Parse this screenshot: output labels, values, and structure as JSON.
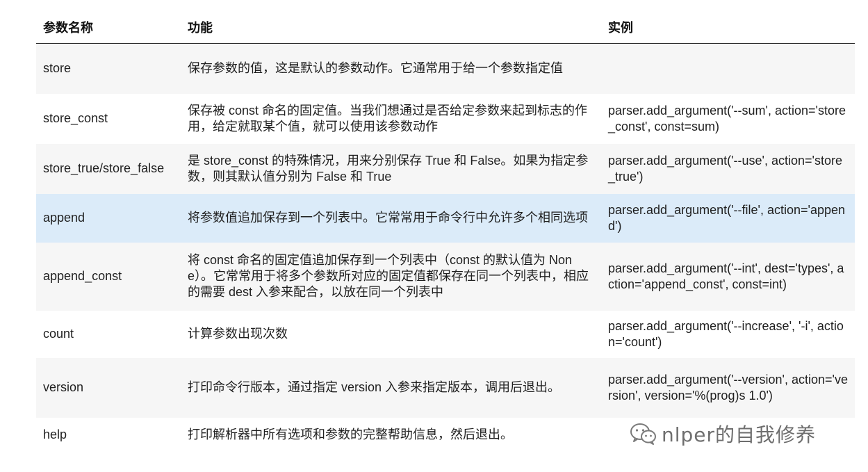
{
  "table": {
    "headers": [
      "参数名称",
      "功能",
      "实例"
    ],
    "rows": [
      {
        "name": "store",
        "function": "保存参数的值，这是默认的参数动作。它通常用于给一个参数指定值",
        "example": ""
      },
      {
        "name": "store_const",
        "function": "保存被 const 命名的固定值。当我们想通过是否给定参数来起到标志的作用，给定就取某个值，就可以使用该参数动作",
        "example": "parser.add_argument('--sum', action='store_const', const=sum)"
      },
      {
        "name": "store_true/store_false",
        "function": "是 store_const 的特殊情况，用来分别保存 True 和 False。如果为指定参数，则其默认值分别为 False 和 True",
        "example": "parser.add_argument('--use', action='store_true')"
      },
      {
        "name": "append",
        "function": "将参数值追加保存到一个列表中。它常常用于命令行中允许多个相同选项",
        "example": "parser.add_argument('--file', action='append')"
      },
      {
        "name": "append_const",
        "function": "将 const 命名的固定值追加保存到一个列表中（const 的默认值为 None）。它常常用于将多个参数所对应的固定值都保存在同一个列表中，相应的需要 dest 入参来配合，以放在同一个列表中",
        "example": "parser.add_argument('--int', dest='types', action='append_const', const=int)"
      },
      {
        "name": "count",
        "function": "计算参数出现次数",
        "example": "parser.add_argument('--increase', '-i', action='count')"
      },
      {
        "name": "version",
        "function": "打印命令行版本，通过指定 version 入参来指定版本，调用后退出。",
        "example": "parser.add_argument('--version', action='version', version='%(prog)s 1.0')"
      },
      {
        "name": "help",
        "function": "打印解析器中所有选项和参数的完整帮助信息，然后退出。",
        "example": ""
      }
    ]
  },
  "watermark": {
    "text": "nlper的自我修养",
    "icon": "wechat-icon"
  },
  "colors": {
    "highlight_row": "#dbebf9",
    "striped_row": "#f6f6f6",
    "header_border": "#2b2b2b"
  }
}
